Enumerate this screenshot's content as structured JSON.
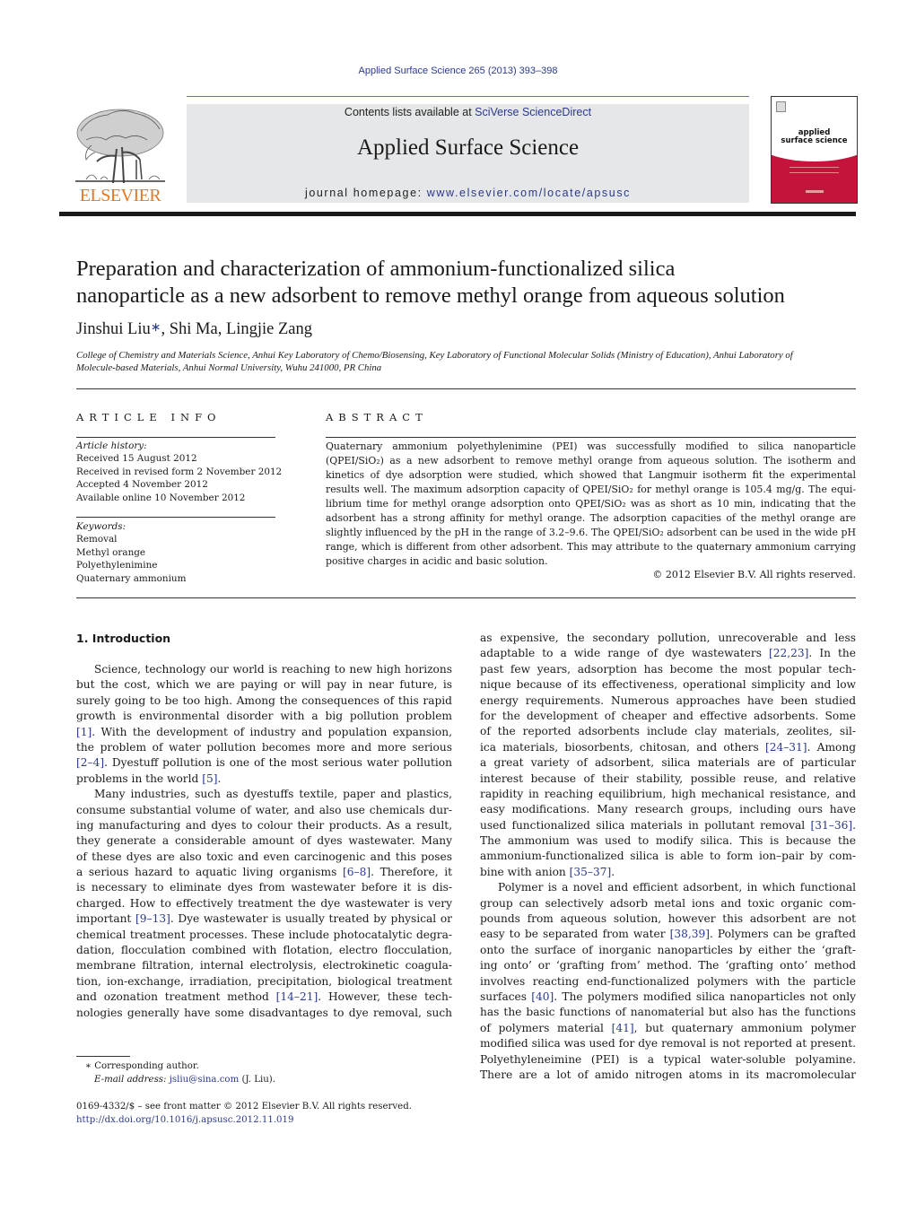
{
  "header": {
    "citation": "Applied Surface Science 265 (2013) 393–398",
    "publisher_logo_text": "ELSEVIER",
    "contents_prefix": "Contents lists available at ",
    "contents_link": "SciVerse ScienceDirect",
    "journal_name": "Applied Surface Science",
    "homepage_prefix": "journal homepage: ",
    "homepage_link": "www.elsevier.com/locate/apsusc",
    "cover_title_line1": "applied",
    "cover_title_line2": "surface science",
    "colors": {
      "link": "#2b3a8c",
      "elsevier_orange": "#e8761e",
      "cover_red": "#c4143c",
      "banner_gray": "#e6e7e8"
    }
  },
  "article": {
    "title_line1": "Preparation and characterization of ammonium-functionalized silica",
    "title_line2": "nanoparticle as a new adsorbent to remove methyl orange from aqueous solution",
    "authors": [
      {
        "name": "Jinshui Liu",
        "mark": "∗",
        "sep": ", "
      },
      {
        "name": "Shi Ma",
        "mark": "",
        "sep": ", "
      },
      {
        "name": "Lingjie Zang",
        "mark": "",
        "sep": ""
      }
    ],
    "affiliation_line1": "College of Chemistry and Materials Science, Anhui Key Laboratory of Chemo/Biosensing, Key Laboratory of Functional Molecular Solids (Ministry of Education), Anhui Laboratory of",
    "affiliation_line2": "Molecule-based Materials, Anhui Normal University, Wuhu 241000, PR China"
  },
  "article_info": {
    "heading": "ARTICLE INFO",
    "history_label": "Article history:",
    "history": [
      "Received 15 August 2012",
      "Received in revised form 2 November 2012",
      "Accepted 4 November 2012",
      "Available online 10 November 2012"
    ],
    "keywords_label": "Keywords:",
    "keywords": [
      "Removal",
      "Methyl orange",
      "Polyethylenimine",
      "Quaternary ammonium"
    ]
  },
  "abstract": {
    "heading": "ABSTRACT",
    "lines": [
      "Quaternary ammonium polyethylenimine (PEI) was successfully modified to silica nanoparticle",
      "(QPEI/SiO₂) as a new adsorbent to remove methyl orange from aqueous solution. The isotherm and",
      "kinetics of dye adsorption were studied, which showed that Langmuir isotherm fit the experimental",
      "results well. The maximum adsorption capacity of QPEI/SiO₂ for methyl orange is 105.4 mg/g. The equi-",
      "librium time for methyl orange adsorption onto QPEI/SiO₂ was as short as 10 min, indicating that the",
      "adsorbent has a strong affinity for methyl orange. The adsorption capacities of the methyl orange are",
      "slightly influenced by the pH in the range of 3.2–9.6. The QPEI/SiO₂ adsorbent can be used in the wide pH",
      "range, which is different from other adsorbent. This may attribute to the quaternary ammonium carrying",
      "positive charges in acidic and basic solution."
    ],
    "copyright": "© 2012 Elsevier B.V. All rights reserved."
  },
  "introduction": {
    "heading": "1.  Introduction",
    "left_column": [
      {
        "t": "Science, technology our world is reaching to new high horizons",
        "indent": true
      },
      {
        "t": "but the cost, which we are paying or will pay in near future, is"
      },
      {
        "t": "surely going to be too high. Among the consequences of this rapid"
      },
      {
        "t": "growth is environmental disorder with a big pollution problem"
      },
      {
        "pre": "",
        "cite": "[1]",
        "post": ". With the development of industry and population expansion,"
      },
      {
        "t": "the problem of water pollution becomes more and more serious"
      },
      {
        "pre": "",
        "cite": "[2–4]",
        "post": ". Dyestuff pollution is one of the most serious water pollution"
      },
      {
        "pre": "problems in the world ",
        "cite": "[5]",
        "post": ".",
        "last": true
      },
      {
        "t": "Many industries, such as dyestuffs textile, paper and plastics,",
        "indent": true
      },
      {
        "t": "consume substantial volume of water, and also use chemicals dur-"
      },
      {
        "t": "ing manufacturing and dyes to colour their products. As a result,"
      },
      {
        "t": "they generate a considerable amount of dyes wastewater. Many"
      },
      {
        "t": "of these dyes are also toxic and even carcinogenic and this poses"
      },
      {
        "pre": "a serious hazard to aquatic living organisms ",
        "cite": "[6–8]",
        "post": ". Therefore, it"
      },
      {
        "t": "is necessary to eliminate dyes from wastewater before it is dis-"
      },
      {
        "t": "charged. How to effectively treatment the dye wastewater is very"
      },
      {
        "pre": "important ",
        "cite": "[9–13]",
        "post": ". Dye wastewater is usually treated by physical or"
      },
      {
        "t": "chemical treatment processes. These include photocatalytic degra-"
      },
      {
        "t": "dation, flocculation combined with flotation, electro flocculation,"
      },
      {
        "t": "membrane filtration, internal electrolysis, electrokinetic coagula-"
      },
      {
        "t": "tion, ion-exchange, irradiation, precipitation, biological treatment"
      },
      {
        "pre": "and ozonation treatment method ",
        "cite": "[14–21]",
        "post": ". However, these tech-"
      },
      {
        "t": "nologies generally have some disadvantages to dye removal, such"
      }
    ],
    "right_column": [
      {
        "t": "as expensive, the secondary pollution, unrecoverable and less"
      },
      {
        "pre": "adaptable to a wide range of dye wastewaters ",
        "cite": "[22,23]",
        "post": ". In the"
      },
      {
        "t": "past few years, adsorption has become the most popular tech-"
      },
      {
        "t": "nique because of its effectiveness, operational simplicity and low"
      },
      {
        "t": "energy requirements. Numerous approaches have been studied"
      },
      {
        "t": "for the development of cheaper and effective adsorbents. Some"
      },
      {
        "t": "of the reported adsorbents include clay materials, zeolites, sil-"
      },
      {
        "pre": "ica materials, biosorbents, chitosan, and others ",
        "cite": "[24–31]",
        "post": ". Among"
      },
      {
        "t": "a great variety of adsorbent, silica materials are of particular"
      },
      {
        "t": "interest because of their stability, possible reuse, and relative"
      },
      {
        "t": "rapidity in reaching equilibrium, high mechanical resistance, and"
      },
      {
        "t": "easy modifications. Many research groups, including ours have"
      },
      {
        "pre": "used functionalized silica materials in pollutant removal ",
        "cite": "[31–36]",
        "post": "."
      },
      {
        "t": "The ammonium was used to modify silica. This is because the"
      },
      {
        "t": "ammonium-functionalized silica is able to form ion–pair by com-"
      },
      {
        "pre": "bine with anion ",
        "cite": "[35–37]",
        "post": ".",
        "last": true
      },
      {
        "t": "Polymer is a novel and efficient adsorbent, in which functional",
        "indent": true
      },
      {
        "t": "group can selectively adsorb metal ions and toxic organic com-"
      },
      {
        "t": "pounds from aqueous solution, however this adsorbent are not"
      },
      {
        "pre": "easy to be separated from water ",
        "cite": "[38,39]",
        "post": ". Polymers can be grafted"
      },
      {
        "t": "onto the surface of inorganic nanoparticles by either the ‘graft-"
      },
      {
        "t": "ing onto’ or ‘grafting from’ method. The ‘grafting onto’ method"
      },
      {
        "t": "involves reacting end-functionalized polymers with the particle"
      },
      {
        "pre": "surfaces ",
        "cite": "[40]",
        "post": ". The polymers modified silica nanoparticles not only"
      },
      {
        "t": "has the basic functions of nanomaterial but also has the functions"
      },
      {
        "pre": "of polymers material ",
        "cite": "[41]",
        "post": ", but quaternary ammonium polymer"
      },
      {
        "t": "modified silica was used for dye removal is not reported at present."
      },
      {
        "t": "Polyethyleneimine (PEI) is a typical water-soluble polyamine."
      },
      {
        "t": "There are a lot of amido nitrogen atoms in its macromolecular"
      }
    ]
  },
  "footnote": {
    "marker": "∗",
    "corresponding": "Corresponding author.",
    "email_label": "E-mail address:",
    "email": "jsliu@sina.com",
    "email_suffix": " (J. Liu)."
  },
  "front_matter": {
    "issn_line": "0169-4332/$ – see front matter © 2012 Elsevier B.V. All rights reserved.",
    "doi": "http://dx.doi.org/10.1016/j.apsusc.2012.11.019"
  }
}
